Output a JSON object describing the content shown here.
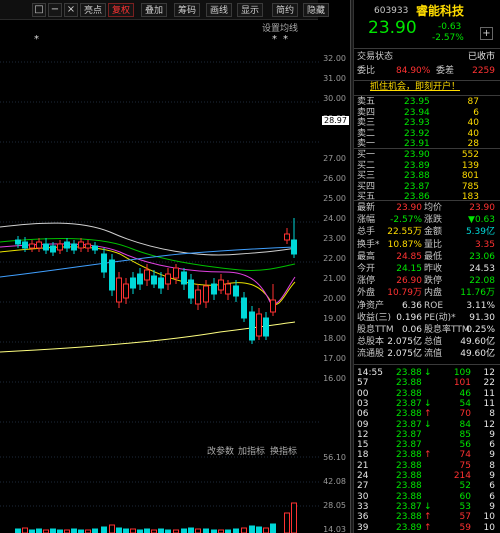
{
  "toolbar": {
    "buttons": [
      "亮点",
      "复权",
      "叠加",
      "筹码",
      "画线",
      "显示",
      "简约",
      "隐藏"
    ],
    "icons": [
      "square-icon",
      "minus-icon",
      "close-icon"
    ]
  },
  "chart": {
    "settings_label": "设置均线",
    "y_ticks": [
      "32.00",
      "31.00",
      "30.00",
      "29.00",
      "28.97",
      "27.00",
      "26.00",
      "25.00",
      "24.00",
      "23.00",
      "22.00",
      "21.00",
      "20.00",
      "19.00",
      "18.00",
      "17.00",
      "16.00"
    ],
    "current_price_tag": "28.97",
    "star_markers": [
      "*",
      "*",
      "*"
    ],
    "sub_toolbar": [
      "改参数",
      "加指标",
      "换指标"
    ],
    "vol_ticks": [
      "56.10",
      "42.08",
      "28.05",
      "14.03"
    ]
  },
  "stock": {
    "code": "603933",
    "name": "睿能科技",
    "price": "23.90",
    "change": "-0.63",
    "change_pct": "-2.57%",
    "trade_status_label": "交易状态",
    "trade_status": "已收市",
    "weibi_label": "委比",
    "weibi": "84.90%",
    "weicha_label": "委差",
    "weicha": "2259",
    "banner": "抓住机会，即刻开户！"
  },
  "asks": [
    {
      "label": "卖五",
      "price": "23.95",
      "vol": "87"
    },
    {
      "label": "卖四",
      "price": "23.94",
      "vol": "6"
    },
    {
      "label": "卖三",
      "price": "23.93",
      "vol": "40"
    },
    {
      "label": "卖二",
      "price": "23.92",
      "vol": "40"
    },
    {
      "label": "卖一",
      "price": "23.91",
      "vol": "28"
    }
  ],
  "bids": [
    {
      "label": "买一",
      "price": "23.90",
      "vol": "552"
    },
    {
      "label": "买二",
      "price": "23.89",
      "vol": "139"
    },
    {
      "label": "买三",
      "price": "23.88",
      "vol": "801"
    },
    {
      "label": "买四",
      "price": "23.87",
      "vol": "785"
    },
    {
      "label": "买五",
      "price": "23.86",
      "vol": "183"
    }
  ],
  "stats": [
    {
      "l1": "最新",
      "v1": "23.90",
      "c1": "red",
      "l2": "均价",
      "v2": "23.90",
      "c2": "red"
    },
    {
      "l1": "涨幅",
      "v1": "-2.57%",
      "c1": "green",
      "l2": "涨跌",
      "v2": "▼0.63",
      "c2": "green"
    },
    {
      "l1": "总手",
      "v1": "22.55万",
      "c1": "yellow",
      "l2": "金额",
      "v2": "5.39亿",
      "c2": "cyan"
    },
    {
      "l1": "换手*",
      "v1": "10.87%",
      "c1": "yellow",
      "l2": "量比",
      "v2": "3.35",
      "c2": "red"
    },
    {
      "l1": "最高",
      "v1": "24.85",
      "c1": "red",
      "l2": "最低",
      "v2": "23.06",
      "c2": "green"
    },
    {
      "l1": "今开",
      "v1": "24.15",
      "c1": "green",
      "l2": "昨收",
      "v2": "24.53",
      "c2": "white"
    },
    {
      "l1": "涨停",
      "v1": "26.90",
      "c1": "red",
      "l2": "跌停",
      "v2": "22.08",
      "c2": "green"
    },
    {
      "l1": "外盘",
      "v1": "10.79万",
      "c1": "red",
      "l2": "内盘",
      "v2": "11.76万",
      "c2": "green"
    },
    {
      "l1": "净资产",
      "v1": "6.36",
      "c1": "white",
      "l2": "ROE",
      "v2": "3.11%",
      "c2": "white"
    },
    {
      "l1": "收益(三)",
      "v1": "0.196",
      "c1": "white",
      "l2": "PE(动)*",
      "v2": "91.30",
      "c2": "white"
    },
    {
      "l1": "股息TTM",
      "v1": "0.06",
      "c1": "white",
      "l2": "股息率TTM",
      "v2": "0.25%",
      "c2": "white"
    },
    {
      "l1": "总股本",
      "v1": "2.075亿",
      "c1": "white",
      "l2": "总值",
      "v2": "49.60亿",
      "c2": "white"
    },
    {
      "l1": "流通股",
      "v1": "2.075亿",
      "c1": "white",
      "l2": "流值",
      "v2": "49.60亿",
      "c2": "white"
    }
  ],
  "ticks": [
    {
      "time": "14:55",
      "price": "23.88",
      "arrow": "↓",
      "ac": "green",
      "vol": "109",
      "vc": "green",
      "n": "12"
    },
    {
      "time": "57",
      "price": "23.88",
      "arrow": "",
      "ac": "",
      "vol": "101",
      "vc": "red",
      "n": "22"
    },
    {
      "time": "00",
      "price": "23.88",
      "arrow": "",
      "ac": "",
      "vol": "46",
      "vc": "green",
      "n": "11"
    },
    {
      "time": "03",
      "price": "23.87",
      "arrow": "↓",
      "ac": "green",
      "vol": "54",
      "vc": "green",
      "n": "11"
    },
    {
      "time": "06",
      "price": "23.88",
      "arrow": "↑",
      "ac": "red",
      "vol": "70",
      "vc": "red",
      "n": "8"
    },
    {
      "time": "09",
      "price": "23.87",
      "arrow": "↓",
      "ac": "green",
      "vol": "84",
      "vc": "green",
      "n": "12"
    },
    {
      "time": "12",
      "price": "23.87",
      "arrow": "",
      "ac": "",
      "vol": "85",
      "vc": "green",
      "n": "9"
    },
    {
      "time": "15",
      "price": "23.87",
      "arrow": "",
      "ac": "",
      "vol": "56",
      "vc": "green",
      "n": "6"
    },
    {
      "time": "18",
      "price": "23.88",
      "arrow": "↑",
      "ac": "red",
      "vol": "74",
      "vc": "red",
      "n": "9"
    },
    {
      "time": "21",
      "price": "23.88",
      "arrow": "",
      "ac": "",
      "vol": "75",
      "vc": "red",
      "n": "8"
    },
    {
      "time": "24",
      "price": "23.88",
      "arrow": "",
      "ac": "",
      "vol": "214",
      "vc": "red",
      "n": "9"
    },
    {
      "time": "27",
      "price": "23.88",
      "arrow": "",
      "ac": "",
      "vol": "52",
      "vc": "green",
      "n": "6"
    },
    {
      "time": "30",
      "price": "23.88",
      "arrow": "",
      "ac": "",
      "vol": "60",
      "vc": "green",
      "n": "6"
    },
    {
      "time": "33",
      "price": "23.87",
      "arrow": "↓",
      "ac": "green",
      "vol": "53",
      "vc": "green",
      "n": "9"
    },
    {
      "time": "36",
      "price": "23.88",
      "arrow": "↑",
      "ac": "red",
      "vol": "57",
      "vc": "red",
      "n": "10"
    },
    {
      "time": "39",
      "price": "23.89",
      "arrow": "↑",
      "ac": "red",
      "vol": "59",
      "vc": "red",
      "n": "10"
    }
  ]
}
